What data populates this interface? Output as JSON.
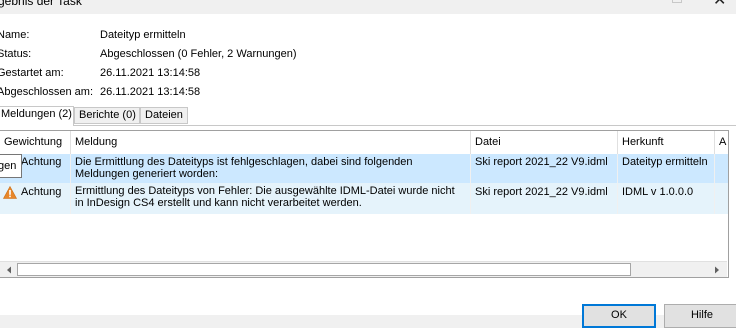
{
  "window": {
    "title": "gebnis der Task"
  },
  "info": {
    "name_label": "Name:",
    "name_value": "Dateityp ermitteln",
    "status_label": "Status:",
    "status_value": "Abgeschlossen (0 Fehler, 2 Warnungen)",
    "started_label": "Gestartet am:",
    "started_value": "26.11.2021 13:14:58",
    "finished_label": "Abgeschlossen am:",
    "finished_value": "26.11.2021 13:14:58"
  },
  "tabs": [
    {
      "label": "Meldungen (2)",
      "active": true
    },
    {
      "label": "Berichte (0)",
      "active": false
    },
    {
      "label": "Dateien",
      "active": false
    }
  ],
  "grid": {
    "columns": [
      "Gewichtung",
      "Meldung",
      "Datei",
      "Herkunft",
      "A"
    ],
    "rows": [
      {
        "severity": "Achtung",
        "message": "Die Ermittlung des Dateityps ist fehlgeschlagen, dabei sind folgenden Meldungen generiert worden:",
        "file": "Ski report 2021_22 V9.idml",
        "origin": "Dateityp ermitteln",
        "icon": "warning-icon"
      },
      {
        "severity": "Achtung",
        "message": "Ermittlung des Dateityps von Fehler: Die ausgewählte IDML-Datei wurde nicht in InDesign CS4 erstellt und kann nicht verarbeitet werden.",
        "file": "Ski report 2021_22 V9.idml",
        "origin": "IDML v 1.0.0.0",
        "icon": "warning-icon"
      }
    ]
  },
  "tooltip": {
    "text": "gen"
  },
  "buttons": {
    "ok": "OK",
    "help": "Hilfe"
  },
  "colors": {
    "selected_row": "#cce8ff",
    "alt_row": "#e5f3fb",
    "warning": "#e8872b"
  }
}
